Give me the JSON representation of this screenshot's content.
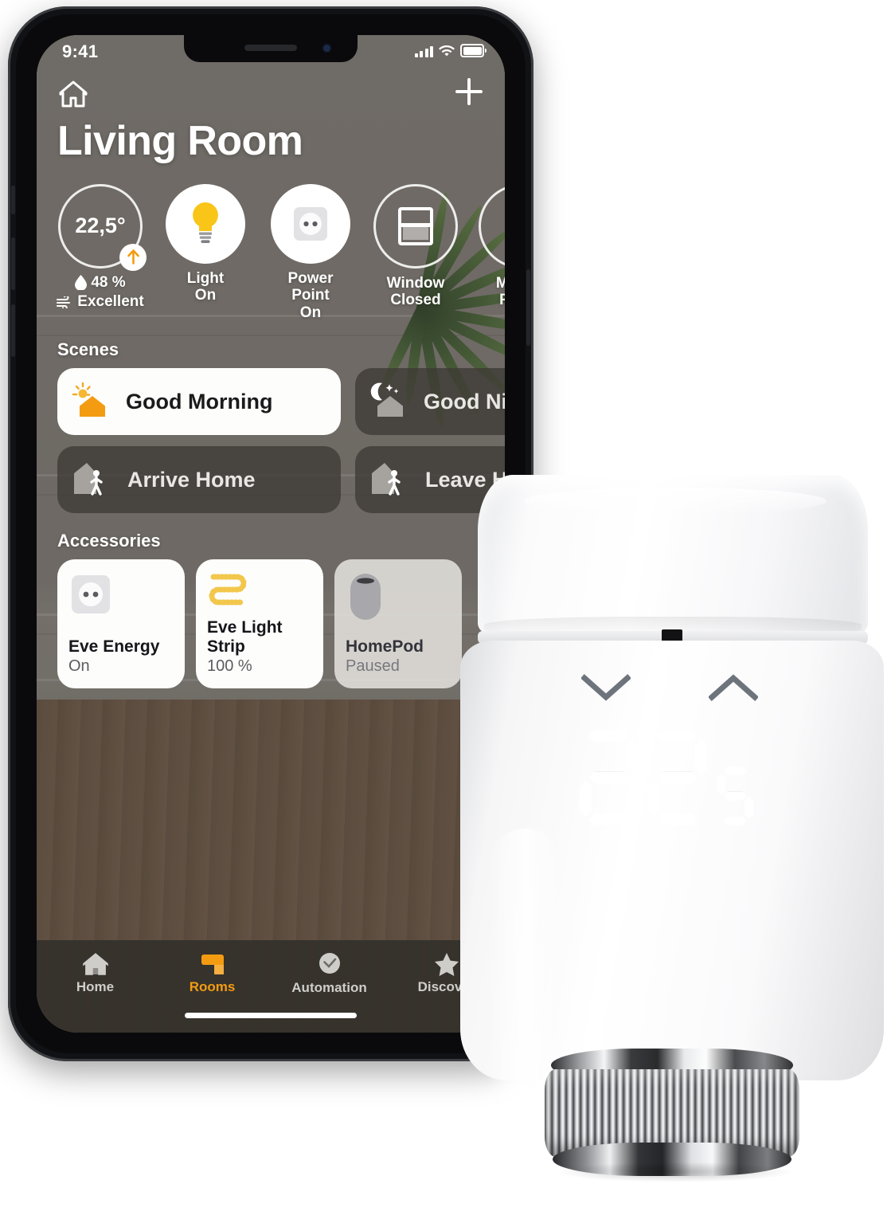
{
  "phone": {
    "status_bar": {
      "time": "9:41",
      "signal_icon": "cellular-signal-icon",
      "wifi_icon": "wifi-icon",
      "battery_icon": "battery-full-icon"
    },
    "app": {
      "top_bar": {
        "home_icon": "house-icon",
        "add_icon": "plus-icon"
      },
      "room_title": "Living Room",
      "status_tiles": [
        {
          "type": "climate",
          "icon": "thermostat-circle",
          "temperature": "22,5°",
          "badge_icon": "arrow-up-icon",
          "humidity_icon": "water-drop-icon",
          "humidity": "48 %",
          "air_quality_icon": "air-quality-icon",
          "air_quality": "Excellent"
        },
        {
          "type": "light",
          "icon": "lightbulb-icon",
          "name": "Light",
          "state": "On"
        },
        {
          "type": "outlet",
          "icon": "power-socket-icon",
          "name": "Power Point",
          "state": "On"
        },
        {
          "type": "window",
          "icon": "window-icon",
          "name": "Window",
          "state": "Closed"
        },
        {
          "type": "motion",
          "icon": "motion-sensor-icon",
          "name": "Motion",
          "state": "Room"
        }
      ],
      "scenes_heading": "Scenes",
      "scenes": [
        {
          "label": "Good Morning",
          "icon": "sun-house-icon",
          "active": true
        },
        {
          "label": "Good Night",
          "icon": "moon-house-icon",
          "active": false
        },
        {
          "label": "Arrive Home",
          "icon": "house-person-arrive-icon",
          "active": false
        },
        {
          "label": "Leave Home",
          "icon": "house-person-leave-icon",
          "active": false
        }
      ],
      "accessories_heading": "Accessories",
      "accessories": [
        {
          "name": "Eve Energy",
          "state": "On",
          "icon": "power-socket-icon",
          "on": true
        },
        {
          "name": "Eve Light Strip",
          "state": "100 %",
          "icon": "light-strip-icon",
          "on": true
        },
        {
          "name": "HomePod",
          "state": "Paused",
          "icon": "homepod-icon",
          "on": false
        }
      ],
      "tabs": [
        {
          "label": "Home",
          "icon": "house-icon",
          "active": false
        },
        {
          "label": "Rooms",
          "icon": "rooms-icon",
          "active": true
        },
        {
          "label": "Automation",
          "icon": "clock-icon",
          "active": false
        },
        {
          "label": "Discover",
          "icon": "star-icon",
          "active": false
        }
      ]
    }
  },
  "thermostat": {
    "display_value": "22",
    "display_decimal": "5",
    "decrease_icon": "chevron-down-icon",
    "increase_icon": "chevron-up-icon",
    "base_icon": "knurled-metal-ring"
  },
  "colors": {
    "accent_orange": "#f39c12",
    "light_yellow": "#f9c519",
    "card_white": "#fdfdfb",
    "card_dark": "rgba(62,58,53,0.78)",
    "device_white": "#ffffff"
  }
}
